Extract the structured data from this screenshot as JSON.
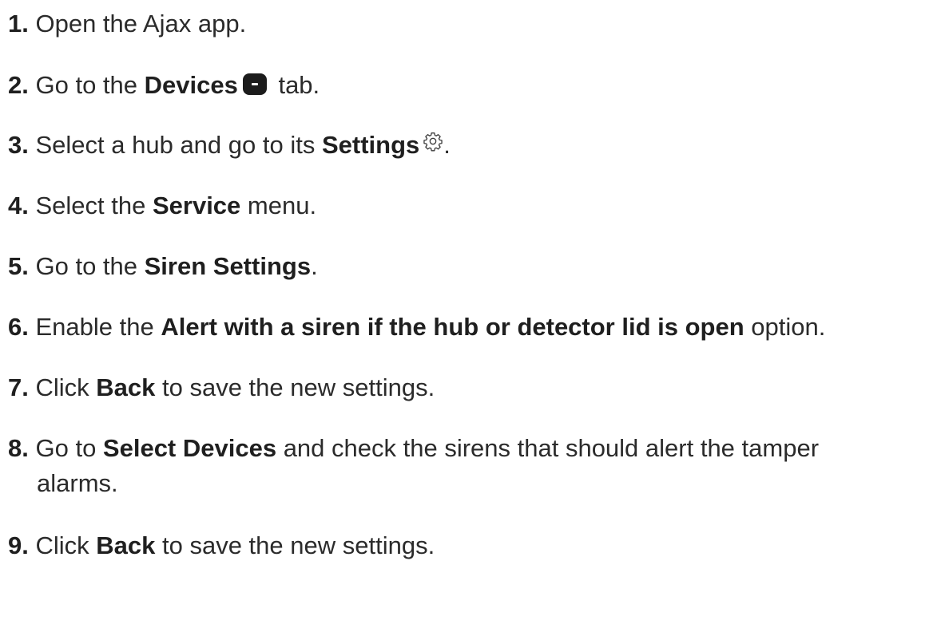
{
  "steps": [
    {
      "num": "1.",
      "text": "Open the Ajax app."
    },
    {
      "num": "2.",
      "pre": "Go to the ",
      "bold": "Devices",
      "icon": "devices-tab-icon",
      "post": " tab."
    },
    {
      "num": "3.",
      "pre": "Select a hub and go to its ",
      "bold": "Settings",
      "icon": "gear-icon",
      "post": "."
    },
    {
      "num": "4.",
      "pre": "Select the ",
      "bold": "Service",
      "post": " menu."
    },
    {
      "num": "5.",
      "pre": "Go to the ",
      "bold": "Siren Settings",
      "post": "."
    },
    {
      "num": "6.",
      "pre": "Enable the ",
      "bold": "Alert with a siren if the hub or detector lid is open",
      "post": " option."
    },
    {
      "num": "7.",
      "pre": "Click ",
      "bold": "Back",
      "post": " to save the new settings."
    },
    {
      "num": "8.",
      "pre": "Go to ",
      "bold": "Select Devices",
      "post": " and check the sirens that should alert the tamper",
      "cont": "alarms."
    },
    {
      "num": "9.",
      "pre": "Click ",
      "bold": "Back",
      "post": " to save the new settings."
    }
  ]
}
